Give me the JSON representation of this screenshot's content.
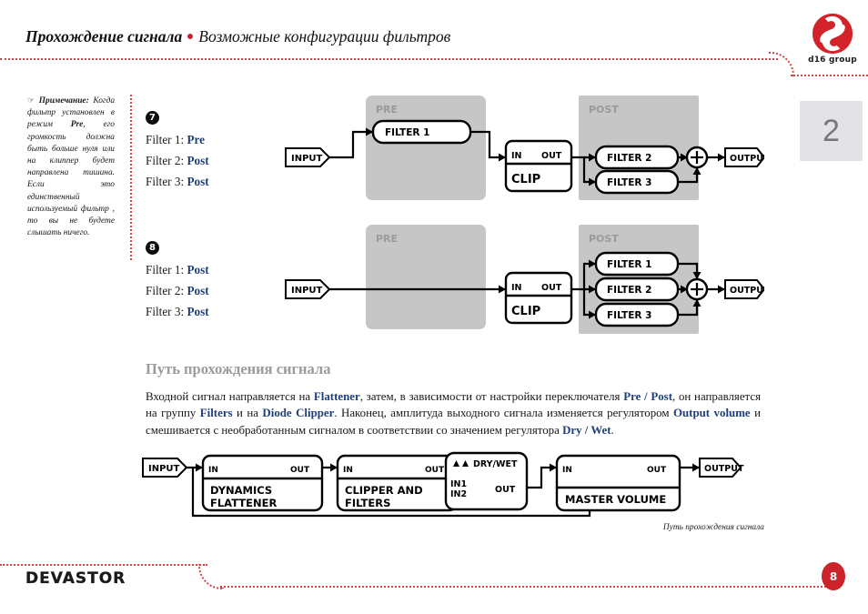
{
  "header": {
    "title_bold": "Прохождение сигнала",
    "separator_icon": "red-dot",
    "title_rest": "Возможные конфигурации фильтров"
  },
  "logo": {
    "name": "d16-group-logo",
    "text": "d16 group"
  },
  "chapter_badge": {
    "number": "2"
  },
  "note": {
    "icon": "hand-pointer-icon",
    "label": "Примечание:",
    "body_part1": "Когда фильтр установлен в режим ",
    "emphasis": "Pre",
    "body_part2": ", его громкость должна быть больше нуля или на клиппер будет направлена тишина. Если это единственный используемый фильтр , то вы не будете слышать ничего."
  },
  "configs": [
    {
      "bullet": "7",
      "rows": [
        {
          "label": "Filter 1:",
          "value": "Pre"
        },
        {
          "label": "Filter 2:",
          "value": "Post"
        },
        {
          "label": "Filter 3:",
          "value": "Post"
        }
      ],
      "diagram": {
        "pre_label": "PRE",
        "post_label": "POST",
        "input_label": "INPUT",
        "output_label": "OUTPUT",
        "clip": {
          "in": "IN",
          "out": "OUT",
          "name": "CLIP"
        },
        "pre_filters": [
          "FILTER 1"
        ],
        "post_filters": [
          "FILTER 2",
          "FILTER 3"
        ],
        "sum_label": "+"
      }
    },
    {
      "bullet": "8",
      "rows": [
        {
          "label": "Filter 1:",
          "value": "Post"
        },
        {
          "label": "Filter 2:",
          "value": "Post"
        },
        {
          "label": "Filter 3:",
          "value": "Post"
        }
      ],
      "diagram": {
        "pre_label": "PRE",
        "post_label": "POST",
        "input_label": "INPUT",
        "output_label": "OUTPUT",
        "clip": {
          "in": "IN",
          "out": "OUT",
          "name": "CLIP"
        },
        "pre_filters": [],
        "post_filters": [
          "FILTER 1",
          "FILTER 2",
          "FILTER 3"
        ],
        "sum_label": "+"
      }
    }
  ],
  "section": {
    "heading": "Путь прохождения сигнала",
    "paragraph": {
      "t1": "Входной сигнал направляется на ",
      "k1": "Flattener",
      "t2": ", затем, в зависимости от настройки переключателя ",
      "k2": "Pre / Post",
      "t3": ", он направляется на группу ",
      "k3": "Filters",
      "t4": " и на ",
      "k4": "Diode Clipper",
      "t5": ". Наконец, амплитуда выходного сигнала изменяется регулятором ",
      "k5": "Output volume",
      "t6": " и смешивается с необработанным сигналом в соответствии со значением регулятора ",
      "k6": "Dry / Wet",
      "t7": "."
    },
    "caption": "Путь прохождения сигнала"
  },
  "signal_path": {
    "input_label": "INPUT",
    "output_label": "OUTPUT",
    "blocks": [
      {
        "in": "IN",
        "out": "OUT",
        "name_line1": "DYNAMICS",
        "name_line2": "FLATTENER"
      },
      {
        "in": "IN",
        "out": "OUT",
        "name_line1": "CLIPPER AND",
        "name_line2": "FILTERS"
      },
      {
        "title": "DRY/WET",
        "in1": "IN1",
        "in2": "IN2",
        "out": "OUT"
      },
      {
        "in": "IN",
        "out": "OUT",
        "name_line1": "MASTER VOLUME"
      }
    ]
  },
  "footer": {
    "product": "DEVASTOR",
    "page": "8"
  },
  "colors": {
    "accent_red": "#cc2229",
    "link_blue": "#1f3f7a",
    "group_gray": "#c6c6c6",
    "badge_gray": "#e3e3e5"
  }
}
